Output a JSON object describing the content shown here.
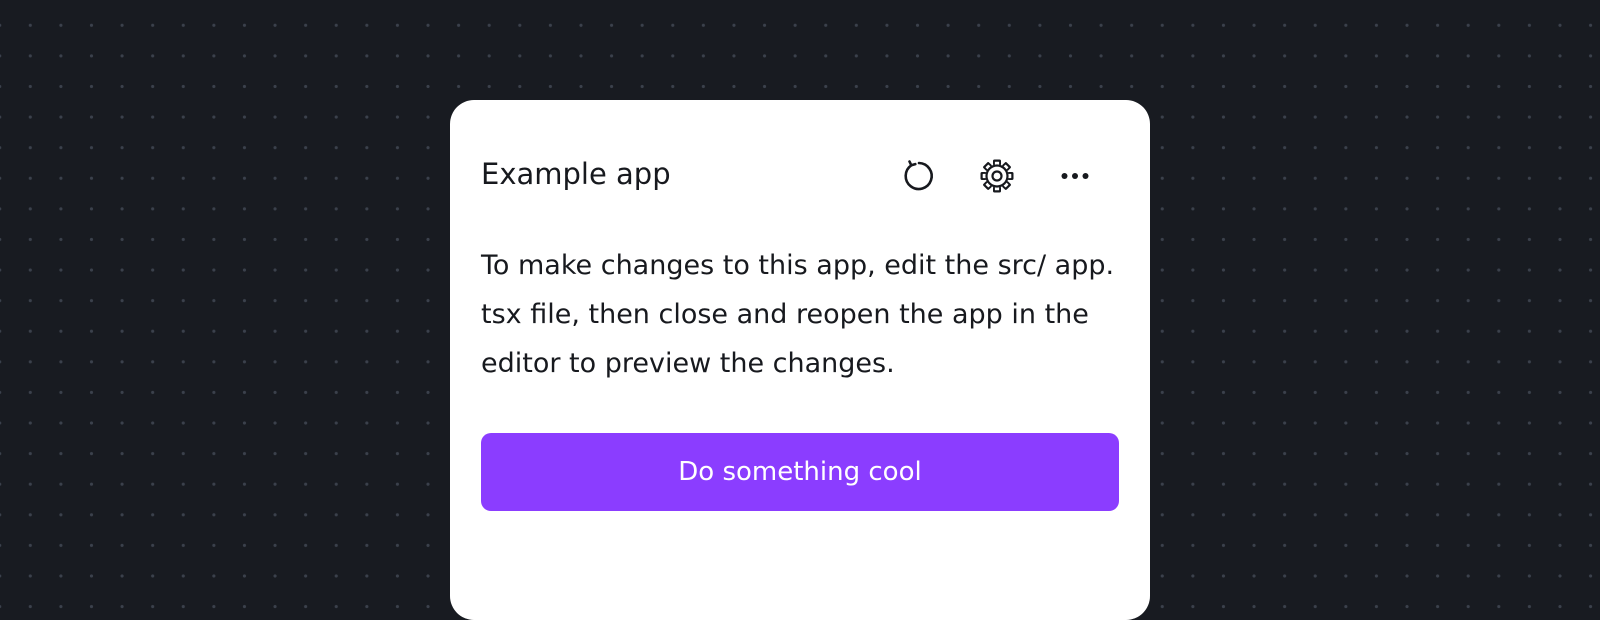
{
  "app": {
    "title": "Example app",
    "description": "To make changes to this app, edit the src/ app. tsx file, then close and reopen the app in the editor to preview the changes.",
    "primary_button_label": "Do something cool"
  },
  "header_actions": [
    {
      "icon": "refresh-icon"
    },
    {
      "icon": "gear-icon"
    },
    {
      "icon": "more-horizontal-icon"
    }
  ],
  "colors": {
    "background": "#181b21",
    "panel": "#ffffff",
    "text": "#17191e",
    "accent": "#8b3dff"
  }
}
